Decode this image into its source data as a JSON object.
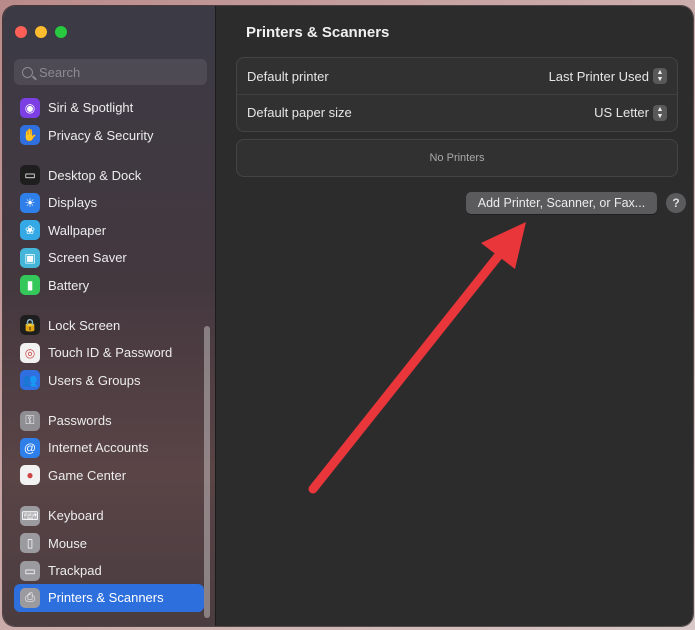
{
  "search": {
    "placeholder": "Search"
  },
  "sidebar": {
    "groups": [
      [
        {
          "label": "Siri & Spotlight",
          "icon": "siri-icon",
          "color": "#7b3fe4"
        },
        {
          "label": "Privacy & Security",
          "icon": "hand-icon",
          "color": "#2f6fe0"
        }
      ],
      [
        {
          "label": "Desktop & Dock",
          "icon": "dock-icon",
          "color": "#1e1e1e"
        },
        {
          "label": "Displays",
          "icon": "sun-icon",
          "color": "#2f7fea"
        },
        {
          "label": "Wallpaper",
          "icon": "flower-icon",
          "color": "#35a9e6"
        },
        {
          "label": "Screen Saver",
          "icon": "screen-saver-icon",
          "color": "#45b6d9"
        },
        {
          "label": "Battery",
          "icon": "battery-icon",
          "color": "#34c759"
        }
      ],
      [
        {
          "label": "Lock Screen",
          "icon": "lock-icon",
          "color": "#1e1e1e"
        },
        {
          "label": "Touch ID & Password",
          "icon": "fingerprint-icon",
          "color": "#f1f1f1"
        },
        {
          "label": "Users & Groups",
          "icon": "users-icon",
          "color": "#2f6fe0"
        }
      ],
      [
        {
          "label": "Passwords",
          "icon": "key-icon",
          "color": "#8e8e93"
        },
        {
          "label": "Internet Accounts",
          "icon": "at-icon",
          "color": "#2f7fea"
        },
        {
          "label": "Game Center",
          "icon": "game-center-icon",
          "color": "#f2f2f2"
        }
      ],
      [
        {
          "label": "Keyboard",
          "icon": "keyboard-icon",
          "color": "#9a9a9f"
        },
        {
          "label": "Mouse",
          "icon": "mouse-icon",
          "color": "#9a9a9f"
        },
        {
          "label": "Trackpad",
          "icon": "trackpad-icon",
          "color": "#9a9a9f"
        },
        {
          "label": "Printers & Scanners",
          "icon": "printer-icon",
          "color": "#9a9a9f",
          "active": true
        }
      ]
    ]
  },
  "main": {
    "title": "Printers & Scanners",
    "default_printer_label": "Default printer",
    "default_printer_value": "Last Printer Used",
    "paper_size_label": "Default paper size",
    "paper_size_value": "US Letter",
    "empty_list_text": "No Printers",
    "add_button_label": "Add Printer, Scanner, or Fax...",
    "help_button_label": "?"
  },
  "annotation": {
    "arrow_color": "#e8363b"
  }
}
